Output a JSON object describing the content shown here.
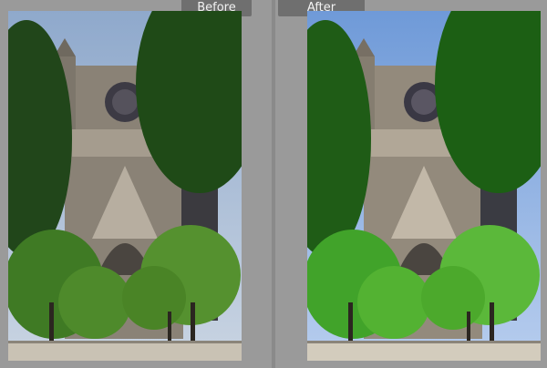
{
  "compare_view": {
    "before_label": "Before",
    "after_label": "After"
  },
  "colors": {
    "background": "#9a9a9a",
    "label_bg": "#6f6f6f",
    "label_text": "#f2f2f2",
    "before_sky": "#9fb6d4",
    "after_sky": "#7fa8e0",
    "before_foliage": "#2f6a1e",
    "after_foliage": "#2d8a1a"
  },
  "photo": {
    "subject": "cathedral-facade-with-orange-trees",
    "before_state": "original",
    "after_state": "enhanced"
  }
}
